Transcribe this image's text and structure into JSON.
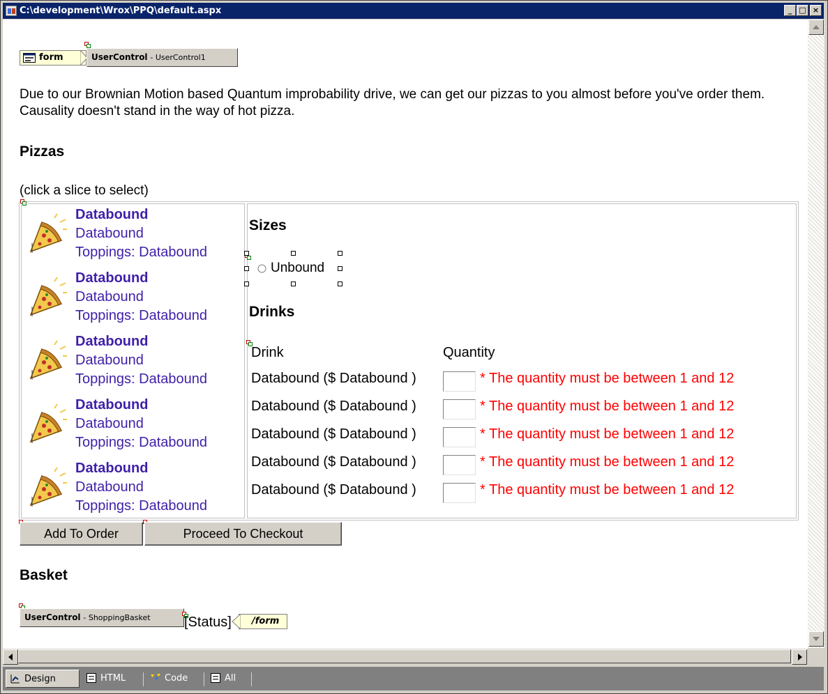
{
  "window": {
    "title": "C:\\development\\Wrox\\PPQ\\default.aspx",
    "controls": {
      "minimize": "_",
      "maximize": "□",
      "close": "×"
    }
  },
  "tags": {
    "form_open": "form",
    "form_close": "/form"
  },
  "user_control_1": {
    "type": "UserControl",
    "name": "- UserControl1"
  },
  "intro_text": "Due to our Brownian Motion based Quantum improbability drive, we can get our pizzas to you almost before you've order them. Causality doesn't stand in the way of hot pizza.",
  "pizzas": {
    "heading": "Pizzas",
    "hint": "(click a slice to select)",
    "items": [
      {
        "name": "Databound",
        "description": "Databound",
        "toppings": "Toppings: Databound",
        "icon": "pizza-slice-icon"
      },
      {
        "name": "Databound",
        "description": "Databound",
        "toppings": "Toppings: Databound",
        "icon": "pizza-slice-icon"
      },
      {
        "name": "Databound",
        "description": "Databound",
        "toppings": "Toppings: Databound",
        "icon": "pizza-slice-icon"
      },
      {
        "name": "Databound",
        "description": "Databound",
        "toppings": "Toppings: Databound",
        "icon": "pizza-slice-icon"
      },
      {
        "name": "Databound",
        "description": "Databound",
        "toppings": "Toppings: Databound",
        "icon": "pizza-slice-icon"
      }
    ]
  },
  "sizes": {
    "heading": "Sizes",
    "radio_label": "Unbound"
  },
  "drinks": {
    "heading": "Drinks",
    "columns": {
      "drink": "Drink",
      "quantity": "Quantity"
    },
    "rows": [
      {
        "label": "Databound ($ Databound )",
        "quantity": "",
        "error": "* The quantity must be between 1 and 12"
      },
      {
        "label": "Databound ($ Databound )",
        "quantity": "",
        "error": "* The quantity must be between 1 and 12"
      },
      {
        "label": "Databound ($ Databound )",
        "quantity": "",
        "error": "* The quantity must be between 1 and 12"
      },
      {
        "label": "Databound ($ Databound )",
        "quantity": "",
        "error": "* The quantity must be between 1 and 12"
      },
      {
        "label": "Databound ($ Databound )",
        "quantity": "",
        "error": "* The quantity must be between 1 and 12"
      }
    ]
  },
  "buttons": {
    "add_to_order": "Add To Order",
    "proceed_to_checkout": "Proceed To Checkout"
  },
  "basket": {
    "heading": "Basket",
    "control_type": "UserControl",
    "control_name": "- ShoppingBasket",
    "status": "[Status]"
  },
  "view_tabs": [
    {
      "label": "Design",
      "icon": "design-icon",
      "active": true
    },
    {
      "label": "HTML",
      "icon": "html-icon",
      "active": false
    },
    {
      "label": "Code",
      "icon": "code-icon",
      "active": false
    },
    {
      "label": "All",
      "icon": "all-icon",
      "active": false
    }
  ],
  "colors": {
    "titlebar": "#0a246a",
    "databound_text": "#3f1fa8",
    "error_text": "#ff0000",
    "tag_bg": "#ffffd8"
  }
}
